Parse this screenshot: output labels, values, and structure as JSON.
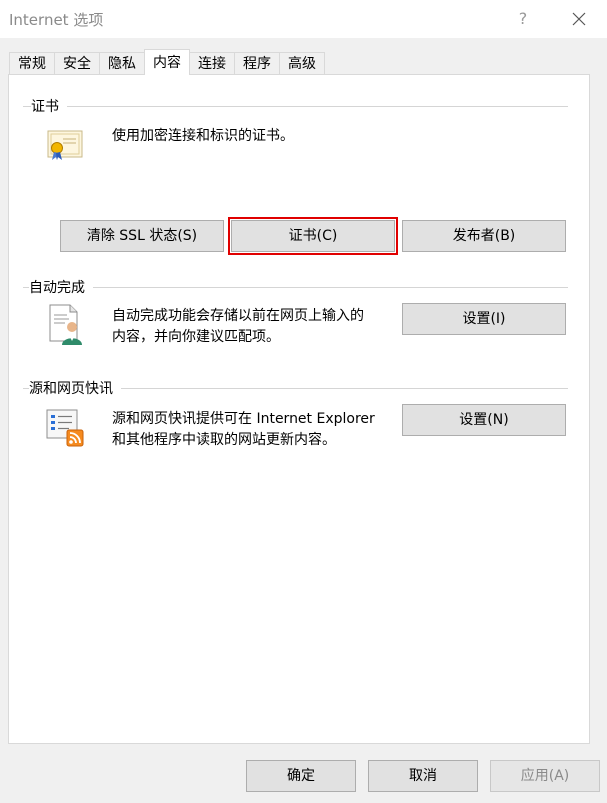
{
  "window": {
    "title": "Internet 选项",
    "help": "?"
  },
  "tabs": [
    {
      "label": "常规"
    },
    {
      "label": "安全"
    },
    {
      "label": "隐私"
    },
    {
      "label": "内容",
      "active": true
    },
    {
      "label": "连接"
    },
    {
      "label": "程序"
    },
    {
      "label": "高级"
    }
  ],
  "certificates": {
    "title": "证书",
    "description": "使用加密连接和标识的证书。",
    "buttons": {
      "clear_ssl": "清除 SSL 状态(S)",
      "certificates": "证书(C)",
      "publishers": "发布者(B)"
    }
  },
  "autocomplete": {
    "title": "自动完成",
    "description_line1": "自动完成功能会存储以前在网页上输入的",
    "description_line2": "内容，并向你建议匹配项。",
    "settings": "设置(I)"
  },
  "feeds": {
    "title": "源和网页快讯",
    "description_line1": "源和网页快讯提供可在 Internet Explorer",
    "description_line2": "和其他程序中读取的网站更新内容。",
    "settings": "设置(N)"
  },
  "footer": {
    "ok": "确定",
    "cancel": "取消",
    "apply": "应用(A)"
  },
  "colors": {
    "focus_outline": "#e00000",
    "body_bg": "#f0f0f0"
  }
}
